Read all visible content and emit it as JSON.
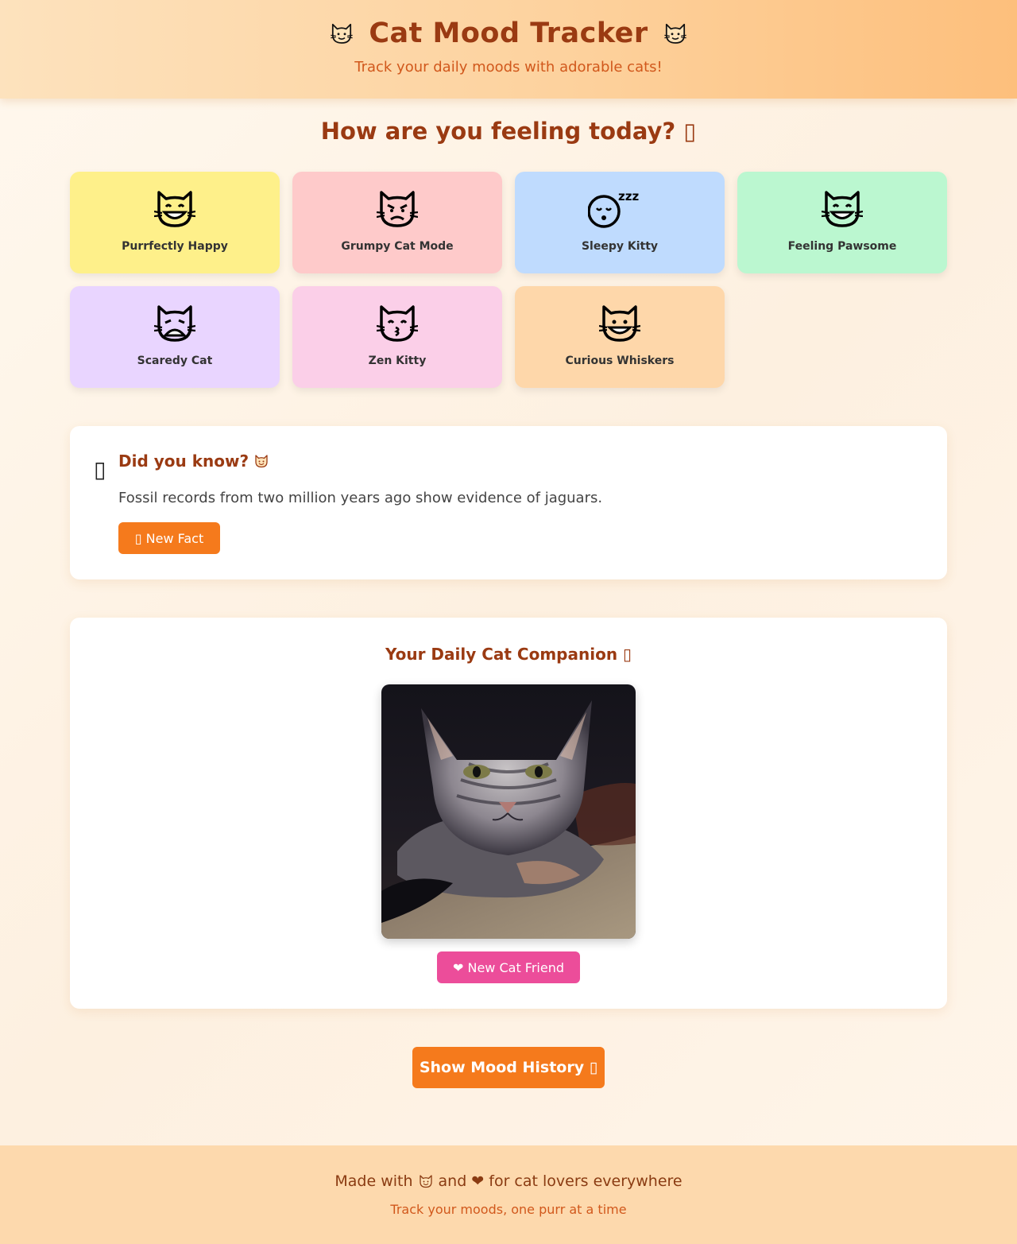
{
  "header": {
    "title": "Cat Mood Tracker",
    "tagline": "Track your daily moods with adorable cats!",
    "left_icon": "cat-face-icon",
    "right_icon": "cat-face-icon"
  },
  "mood_section": {
    "title": "How are you feeling today? ▯"
  },
  "moods": [
    {
      "label": "Purrfectly Happy",
      "icon": "grinning-cat-icon",
      "color": "#fef08a"
    },
    {
      "label": "Grumpy Cat Mode",
      "icon": "pouting-cat-icon",
      "color": "#fecaca"
    },
    {
      "label": "Sleepy Kitty",
      "icon": "sleeping-face-icon",
      "color": "#bfdbfe"
    },
    {
      "label": "Feeling Pawsome",
      "icon": "grinning-cat-icon",
      "color": "#bbf7d0"
    },
    {
      "label": "Scaredy Cat",
      "icon": "weary-cat-icon",
      "color": "#e9d5ff"
    },
    {
      "label": "Zen Kitty",
      "icon": "kissing-cat-icon",
      "color": "#fbcfe8"
    },
    {
      "label": "Curious Whiskers",
      "icon": "smiling-cat-icon",
      "color": "#fed7aa"
    }
  ],
  "fact": {
    "icon": "lightbulb-icon",
    "title": "Did you know?",
    "text": "Fossil records from two million years ago show evidence of jaguars.",
    "button": "▯ New Fact"
  },
  "companion": {
    "title": "Your Daily Cat Companion ▯",
    "button": "❤ New Cat Friend"
  },
  "history_button": "Show Mood History ▯",
  "footer": {
    "made_prefix": "Made with",
    "made_and": "and ❤ for cat lovers everywhere",
    "sub": "Track your moods, one purr at a time"
  },
  "colors": {
    "accent": "#f57a1c",
    "pink": "#ec4d9a",
    "title": "#9a3a12"
  }
}
